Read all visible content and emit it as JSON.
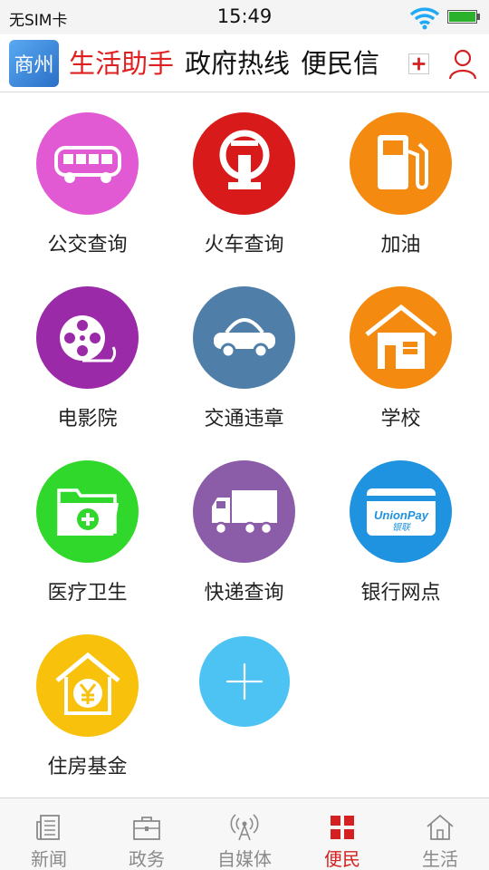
{
  "status_bar": {
    "carrier": "无SIM卡",
    "time": "15:49"
  },
  "header": {
    "logo_text": "商州",
    "tabs": [
      {
        "label": "生活助手",
        "active": true
      },
      {
        "label": "政府热线",
        "active": false
      },
      {
        "label": "便民信",
        "active": false
      }
    ],
    "add_tab_icon": "plus-box-icon",
    "user_icon": "user-icon"
  },
  "services": [
    {
      "label": "公交查询",
      "icon": "bus-icon",
      "color": "#e25ad3"
    },
    {
      "label": "火车查询",
      "icon": "railway-icon",
      "color": "#d81a1a"
    },
    {
      "label": "加油",
      "icon": "fuel-pump-icon",
      "color": "#f58a10"
    },
    {
      "label": "电影院",
      "icon": "film-reel-icon",
      "color": "#9b2aa9"
    },
    {
      "label": "交通违章",
      "icon": "car-icon",
      "color": "#4f7ea8"
    },
    {
      "label": "学校",
      "icon": "school-icon",
      "color": "#f58a10"
    },
    {
      "label": "医疗卫生",
      "icon": "medical-folder-icon",
      "color": "#2fd82a"
    },
    {
      "label": "快递查询",
      "icon": "truck-icon",
      "color": "#8b5ca8"
    },
    {
      "label": "银行网点",
      "icon": "unionpay-card-icon",
      "color": "#1f92e0"
    },
    {
      "label": "住房基金",
      "icon": "housing-fund-icon",
      "color": "#f8c20c"
    }
  ],
  "add_service_icon": "plus-icon",
  "add_service_color": "#4cc3f2",
  "unionpay_text": "UnionPay",
  "unionpay_cn": "银联",
  "tabbar": {
    "items": [
      {
        "label": "新闻",
        "icon": "newspaper-icon",
        "active": false
      },
      {
        "label": "政务",
        "icon": "briefcase-icon",
        "active": false
      },
      {
        "label": "自媒体",
        "icon": "broadcast-icon",
        "active": false
      },
      {
        "label": "便民",
        "icon": "grid-icon",
        "active": true
      },
      {
        "label": "生活",
        "icon": "home-icon",
        "active": false
      }
    ],
    "active_color": "#d42020",
    "inactive_color": "#8a8a8a"
  }
}
